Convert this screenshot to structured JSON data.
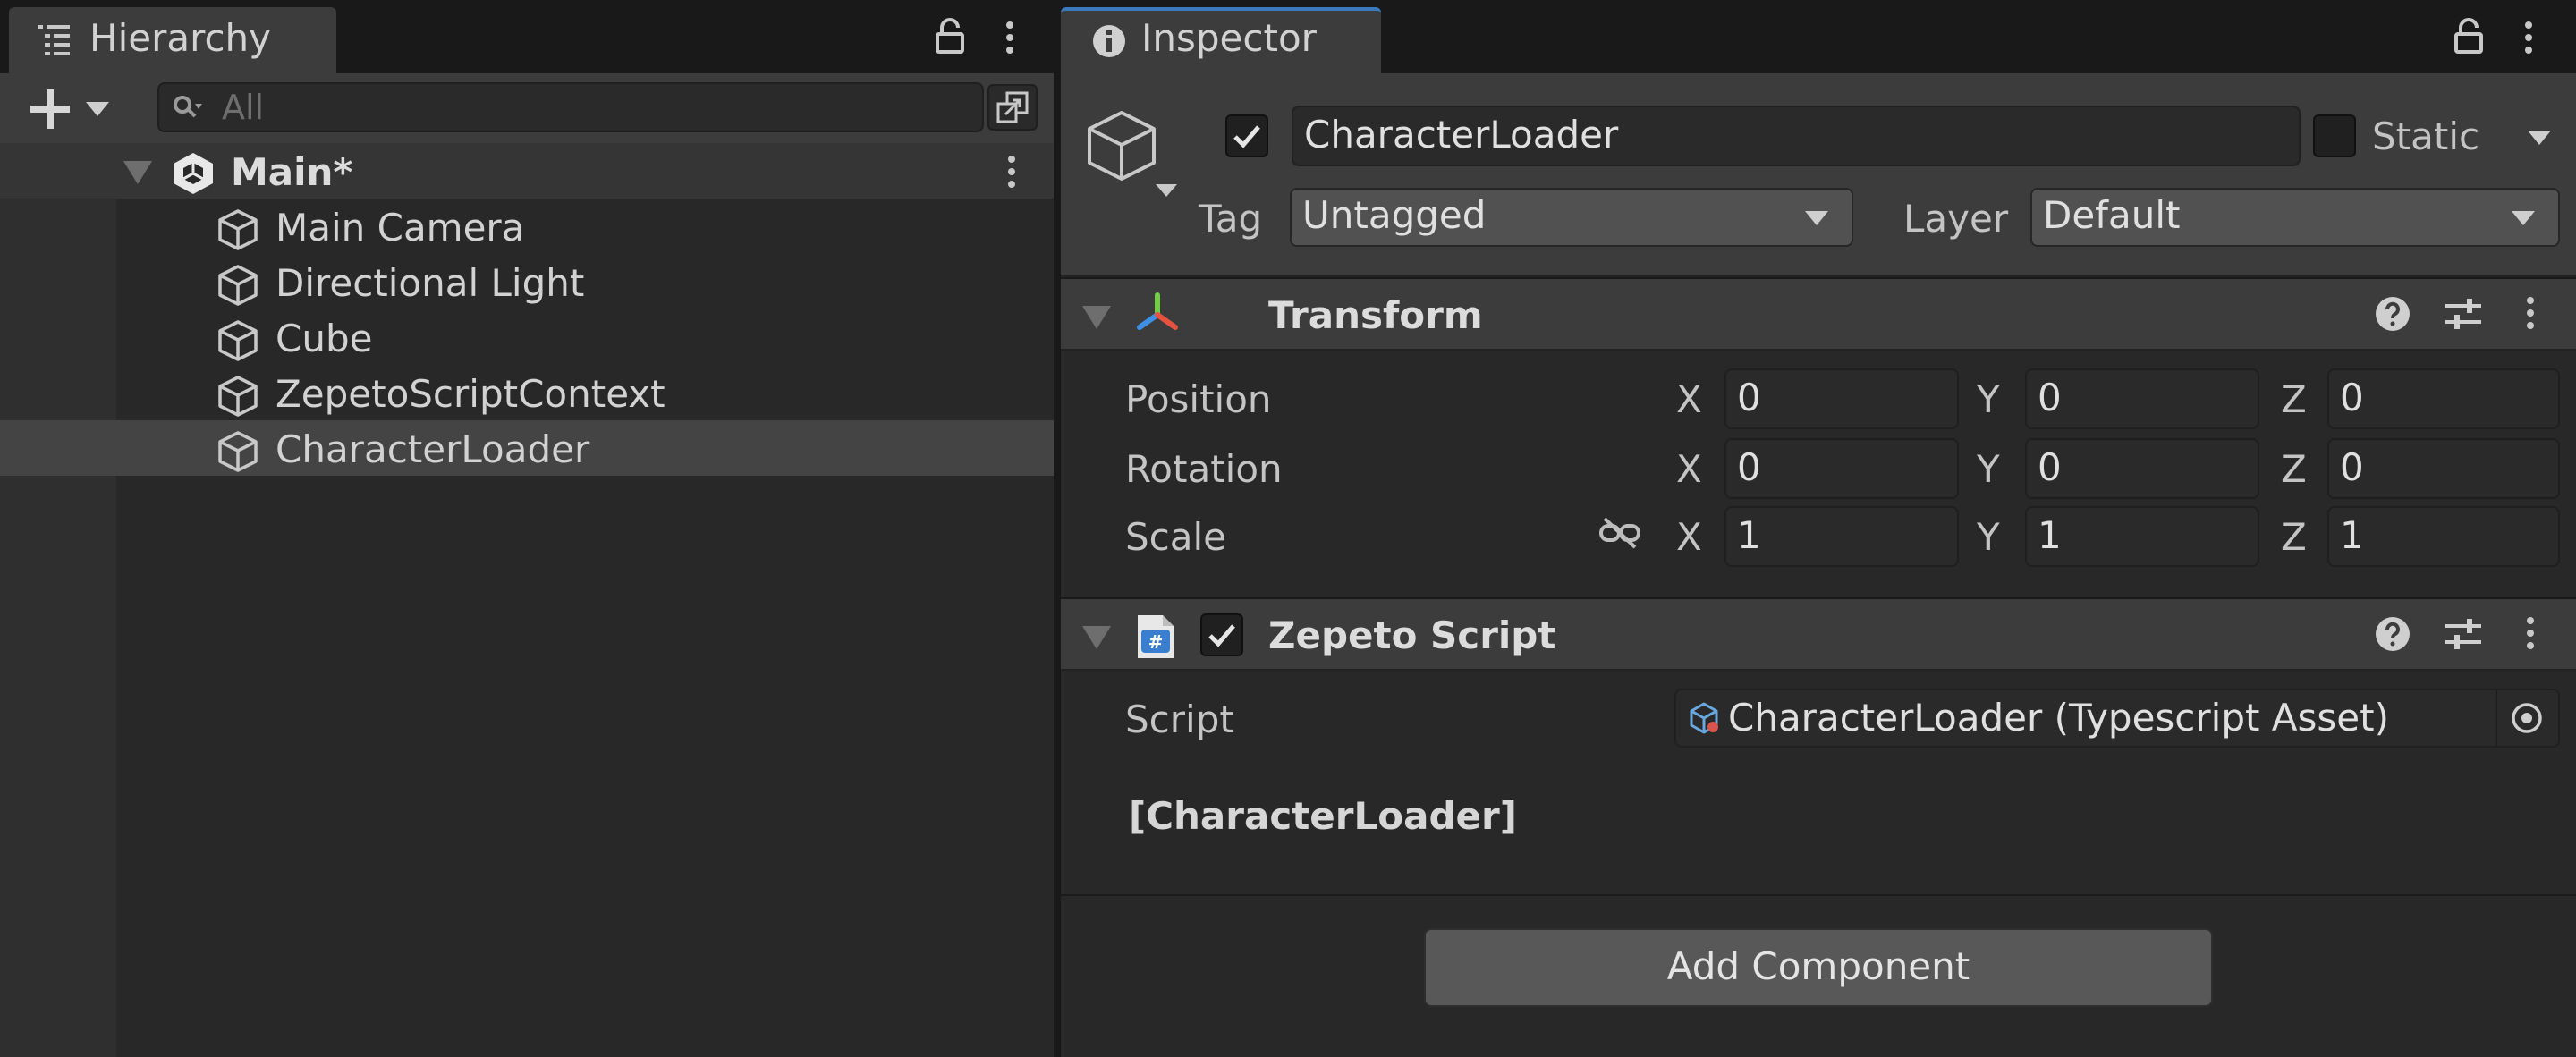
{
  "hierarchy": {
    "tab_label": "Hierarchy",
    "search_placeholder": "All",
    "scene_name": "Main*",
    "items": [
      {
        "label": "Main Camera",
        "selected": false
      },
      {
        "label": "Directional Light",
        "selected": false
      },
      {
        "label": "Cube",
        "selected": false
      },
      {
        "label": "ZepetoScriptContext",
        "selected": false
      },
      {
        "label": "CharacterLoader",
        "selected": true
      }
    ],
    "icons": [
      "hierarchy-list-icon",
      "lock-icon",
      "more-icon",
      "add-icon",
      "dropdown-arrow-icon",
      "search-icon",
      "scene-view-toggle-icon",
      "unity-scene-icon",
      "gameobject-cube-icon"
    ]
  },
  "inspector": {
    "tab_label": "Inspector",
    "object": {
      "name": "CharacterLoader",
      "active": true,
      "static_label": "Static",
      "static": false,
      "tag_label": "Tag",
      "tag_value": "Untagged",
      "layer_label": "Layer",
      "layer_value": "Default"
    },
    "transform": {
      "title": "Transform",
      "rows": [
        {
          "label": "Position",
          "x": "0",
          "y": "0",
          "z": "0"
        },
        {
          "label": "Rotation",
          "x": "0",
          "y": "0",
          "z": "0"
        },
        {
          "label": "Scale",
          "x": "1",
          "y": "1",
          "z": "1"
        }
      ],
      "axis_labels": {
        "x": "X",
        "y": "Y",
        "z": "Z"
      }
    },
    "zepeto_script": {
      "title": "Zepeto Script",
      "enabled": true,
      "script_label": "Script",
      "script_value": "CharacterLoader (Typescript Asset)",
      "class_label": "[CharacterLoader]"
    },
    "add_component_label": "Add Component"
  },
  "colors": {
    "panel_bg": "#282828",
    "header_bg": "#3c3c3c",
    "tab_bar_bg": "#191919",
    "selected_row": "#444444",
    "active_tab_accent": "#3a79bb",
    "text": "#d2d2d2"
  }
}
